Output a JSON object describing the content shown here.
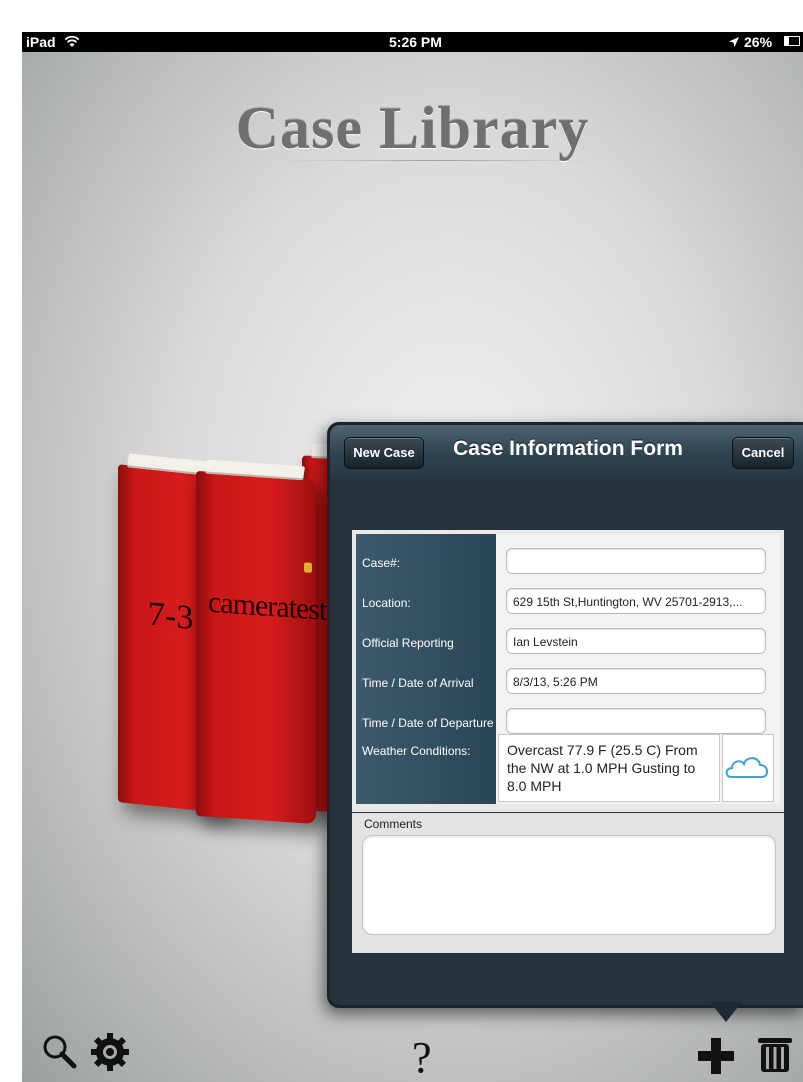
{
  "status_bar": {
    "device": "iPad",
    "time": "5:26 PM",
    "battery": "26%"
  },
  "library": {
    "title": "Case Library",
    "books": [
      {
        "label": "7-31"
      },
      {
        "label": "cameratest"
      },
      {
        "label": ""
      }
    ]
  },
  "form": {
    "title": "Case Information Form",
    "new_case_label": "New Case",
    "cancel_label": "Cancel",
    "fields": {
      "case_label": "Case#:",
      "case_value": "",
      "location_label": "Location:",
      "location_value": "629 15th St,Huntington, WV  25701-2913,...",
      "official_label": "Official Reporting",
      "official_value": "Ian Levstein",
      "arrival_label": "Time / Date of Arrival",
      "arrival_value": "8/3/13, 5:26 PM",
      "departure_label": "Time / Date of Departure",
      "departure_value": "",
      "weather_label": "Weather Conditions:",
      "weather_value": "Overcast 77.9 F (25.5 C) From the NW at 1.0 MPH Gusting to 8.0 MPH",
      "weather_icon": "cloud-icon"
    },
    "comments_label": "Comments",
    "comments_value": ""
  },
  "toolbar": {
    "help_label": "?",
    "icons": [
      "search-icon",
      "gear-icon",
      "add-icon",
      "trash-icon"
    ]
  },
  "colors": {
    "book_red": "#d81c1c",
    "popover_bg": "#26323c",
    "label_column": "#3c5a6d"
  }
}
